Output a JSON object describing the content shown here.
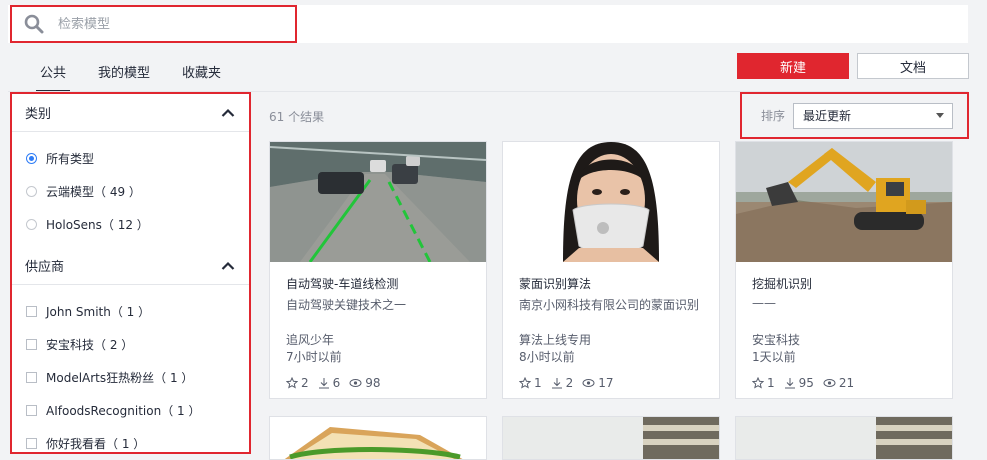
{
  "search": {
    "placeholder": "检索模型"
  },
  "tabs": [
    {
      "label": "公共",
      "active": true
    },
    {
      "label": "我的模型",
      "active": false
    },
    {
      "label": "收藏夹",
      "active": false
    }
  ],
  "actions": {
    "new_label": "新建",
    "docs_label": "文档",
    "accent": "#e0262f"
  },
  "sidebar": {
    "category": {
      "title": "类别",
      "options": [
        {
          "label": "所有类型",
          "selected": true
        },
        {
          "label": "云端模型（ 49 ）",
          "selected": false
        },
        {
          "label": "HoloSens（ 12 ）",
          "selected": false
        }
      ]
    },
    "vendor": {
      "title": "供应商",
      "options": [
        {
          "label": "John Smith（ 1 ）"
        },
        {
          "label": "安宝科技（ 2 ）"
        },
        {
          "label": "ModelArts狂热粉丝（ 1 ）"
        },
        {
          "label": "AIfoodsRecognition（ 1 ）"
        },
        {
          "label": "你好我看看（ 1 ）"
        }
      ]
    }
  },
  "results": {
    "count_label": "61 个结果",
    "sort_label": "排序",
    "sort_value": "最近更新"
  },
  "cards": [
    {
      "title": "自动驾驶-车道线检测",
      "desc": "自动驾驶关键技术之一",
      "author": "追风少年",
      "time": "7小时以前",
      "stars": "2",
      "downloads": "6",
      "views": "98"
    },
    {
      "title": "蒙面识别算法",
      "desc": "南京小网科技有限公司的蒙面识别",
      "author": "算法上线专用",
      "time": "8小时以前",
      "stars": "1",
      "downloads": "2",
      "views": "17"
    },
    {
      "title": "挖掘机识别",
      "desc": "——",
      "author": "安宝科技",
      "time": "1天以前",
      "stars": "1",
      "downloads": "95",
      "views": "21"
    }
  ]
}
